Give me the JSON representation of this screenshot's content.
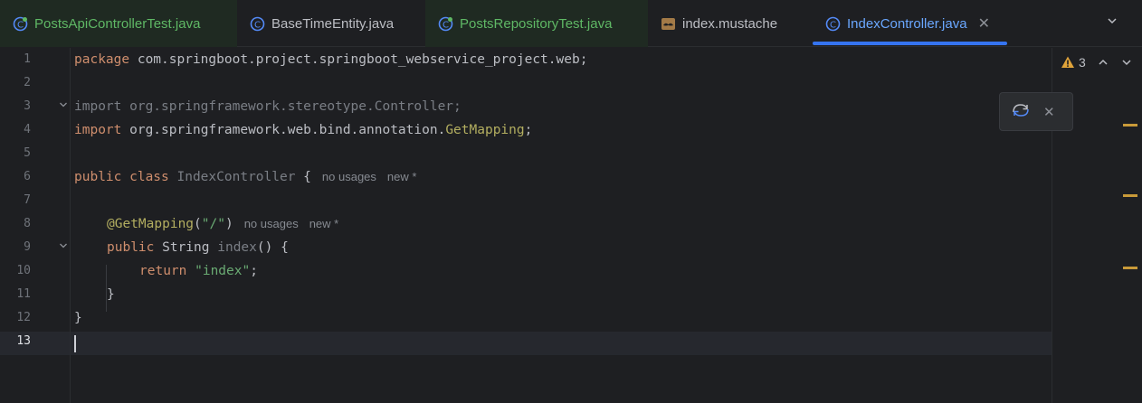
{
  "tabs": [
    {
      "label": "PostsApiControllerTest.java",
      "kind": "test-class"
    },
    {
      "label": "BaseTimeEntity.java",
      "kind": "class"
    },
    {
      "label": "PostsRepositoryTest.java",
      "kind": "test-class"
    },
    {
      "label": "index.mustache",
      "kind": "mustache"
    },
    {
      "label": "IndexController.java",
      "kind": "class",
      "active": true
    }
  ],
  "editor": {
    "line_numbers": [
      "1",
      "2",
      "3",
      "4",
      "5",
      "6",
      "7",
      "8",
      "9",
      "10",
      "11",
      "12",
      "13"
    ],
    "current_line": "13",
    "lines": {
      "l1_kw": "package",
      "l1_rest": " com.springboot.project.springboot_webservice_project.web;",
      "l3": "import org.springframework.stereotype.Controller;",
      "l4_kw": "import",
      "l4_pkg": " org.springframework.web.bind.annotation.",
      "l4_ann": "GetMapping",
      "l4_end": ";",
      "l6_kw": "public class",
      "l6_cls": " IndexController",
      "l6_brace": " {",
      "l6_hint1": "no usages",
      "l6_hint2": "new *",
      "l8_ann": "@GetMapping",
      "l8_open": "(",
      "l8_str": "\"/\"",
      "l8_close": ")",
      "l8_hint1": "no usages",
      "l8_hint2": "new *",
      "l9_kw": "public",
      "l9_type": " String",
      "l9_fn": " index",
      "l9_rest": "() {",
      "l10_kw": "return",
      "l10_str": " \"index\"",
      "l10_end": ";",
      "l11": "}",
      "l12": "}"
    }
  },
  "inspections": {
    "warning_count": "3"
  },
  "colors": {
    "accent": "#3574f0",
    "warning": "#c99a39",
    "background": "#1e1f22"
  }
}
